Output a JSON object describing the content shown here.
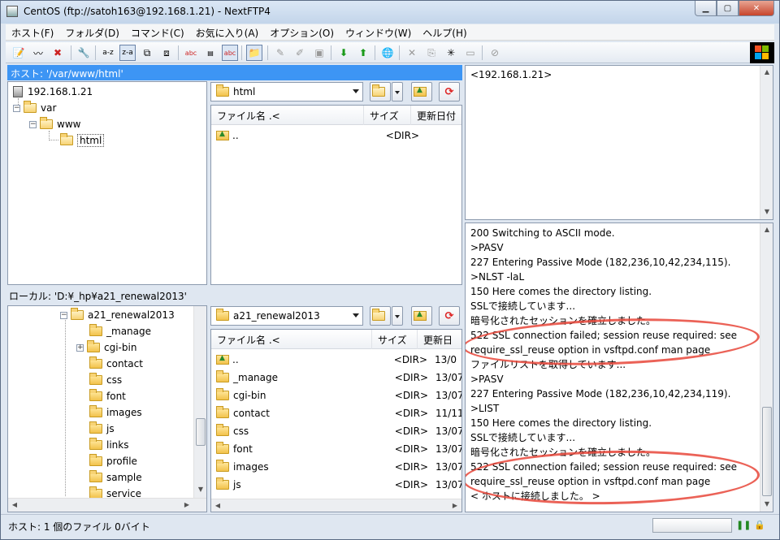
{
  "window": {
    "title": "CentOS (ftp://satoh163@192.168.1.21) - NextFTP4"
  },
  "menu": [
    {
      "label": "ホスト(F)"
    },
    {
      "label": "フォルダ(D)"
    },
    {
      "label": "コマンド(C)"
    },
    {
      "label": "お気に入り(A)"
    },
    {
      "label": "オプション(O)"
    },
    {
      "label": "ウィンドウ(W)"
    },
    {
      "label": "ヘルプ(H)"
    }
  ],
  "remote": {
    "host_path": "ホスト: '/var/www/html'",
    "tree": {
      "server": "192.168.1.21",
      "var": "var",
      "www": "www",
      "html": "html"
    },
    "folder_combo": "html",
    "columns": {
      "name": "ファイル名 .<",
      "size": "サイズ",
      "date": "更新日付"
    },
    "files": [
      {
        "name": "..",
        "size": "<DIR>"
      }
    ]
  },
  "local": {
    "path_label": "ローカル: 'D:¥_hp¥a21_renewal2013'",
    "tree": {
      "root": "a21_renewal2013",
      "children": [
        "_manage",
        "cgi-bin",
        "contact",
        "css",
        "font",
        "images",
        "js",
        "links",
        "profile",
        "sample",
        "service"
      ]
    },
    "folder_combo": "a21_renewal2013",
    "columns": {
      "name": "ファイル名 .<",
      "size": "サイズ",
      "date": "更新日"
    },
    "files": [
      {
        "name": "..",
        "size": "<DIR>",
        "date": "13/0"
      },
      {
        "name": "_manage",
        "size": "<DIR>",
        "date": "13/07"
      },
      {
        "name": "cgi-bin",
        "size": "<DIR>",
        "date": "13/07"
      },
      {
        "name": "contact",
        "size": "<DIR>",
        "date": "11/11"
      },
      {
        "name": "css",
        "size": "<DIR>",
        "date": "13/07"
      },
      {
        "name": "font",
        "size": "<DIR>",
        "date": "13/07"
      },
      {
        "name": "images",
        "size": "<DIR>",
        "date": "13/07"
      },
      {
        "name": "js",
        "size": "<DIR>",
        "date": "13/07"
      }
    ]
  },
  "info_panel": {
    "host": "<192.168.1.21>"
  },
  "log": [
    "200 Switching to ASCII mode.",
    ">PASV",
    "227 Entering Passive Mode (182,236,10,42,234,115).",
    ">NLST -laL",
    "150 Here comes the directory listing.",
    "SSLで接続しています...",
    "暗号化されたセッションを確立しました。",
    "522 SSL connection failed; session reuse required: see",
    "require_ssl_reuse option in vsftpd.conf man page",
    "ファイルリストを取得しています...",
    ">PASV",
    "227 Entering Passive Mode (182,236,10,42,234,119).",
    ">LIST",
    "150 Here comes the directory listing.",
    "SSLで接続しています...",
    "暗号化されたセッションを確立しました。",
    "522 SSL connection failed; session reuse required: see",
    "require_ssl_reuse option in vsftpd.conf man page",
    "< ホストに接続しました。 >"
  ],
  "status": {
    "text": "ホスト: 1 個のファイル  0バイト"
  },
  "colors": {
    "host_bar": "#3d95f4",
    "annotation": "#e8473a"
  }
}
